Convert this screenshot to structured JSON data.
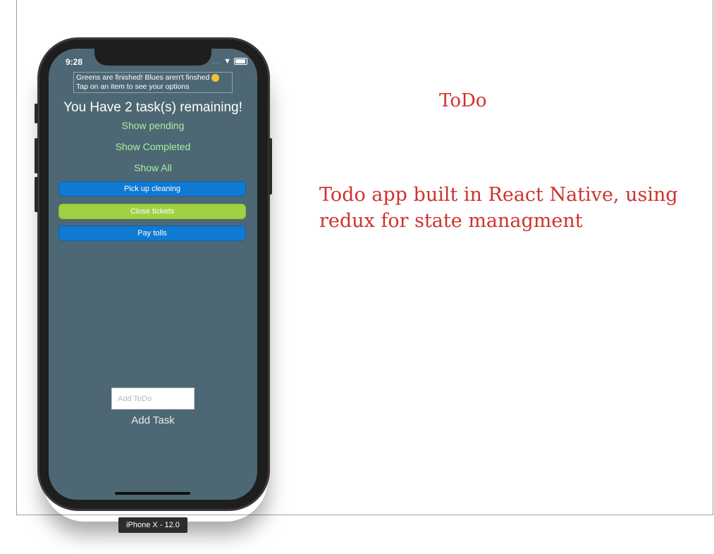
{
  "slide": {
    "title": "ToDo",
    "description": "Todo app built in React Native, using redux for state managment",
    "text_color": "#d0322d"
  },
  "phone": {
    "status_time": "9:28",
    "hint_line1": "Greens are finished! Blues aren't finshed",
    "hint_line2": "Tap on an item to see your options",
    "remaining": "You Have 2 task(s) remaining!",
    "filters": {
      "pending": "Show pending",
      "completed": "Show Completed",
      "all": "Show All"
    },
    "tasks": [
      {
        "label": "Pick up cleaning",
        "status": "pending",
        "color": "#0f7ad1"
      },
      {
        "label": "Close tickets",
        "status": "completed",
        "color": "#a0d044"
      },
      {
        "label": "Pay tolls",
        "status": "pending",
        "color": "#0f7ad1"
      }
    ],
    "add_input_placeholder": "Add ToDo",
    "add_input_value": "",
    "add_button": "Add Task",
    "screen_color": "#4d6874"
  },
  "simulator_label": "iPhone X - 12.0"
}
